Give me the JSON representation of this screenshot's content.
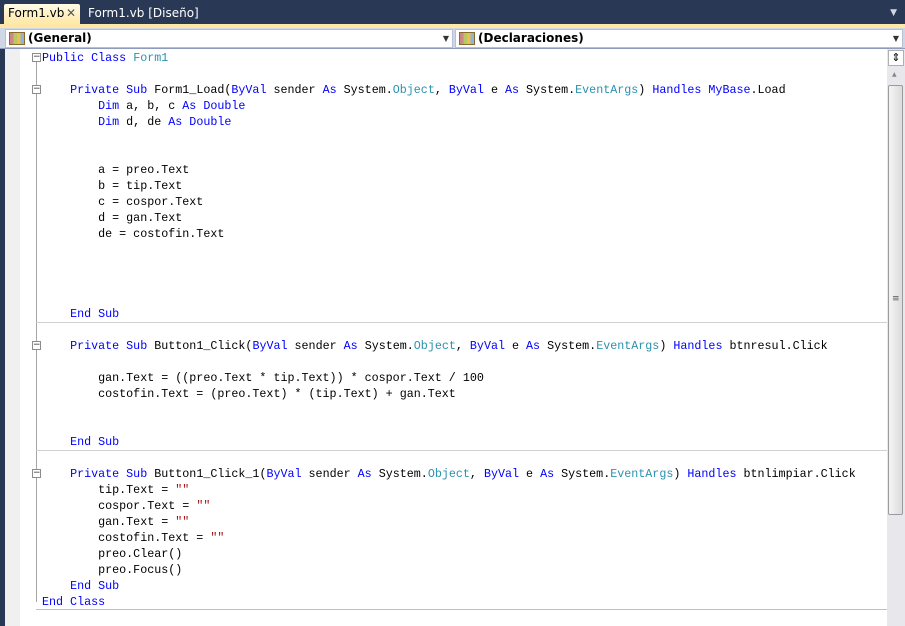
{
  "tabs": [
    {
      "label": "Form1.vb",
      "active": true,
      "close": "✕"
    },
    {
      "label": "Form1.vb [Diseño]",
      "active": false
    }
  ],
  "navbar": {
    "left_combo": "(General)",
    "right_combo": "(Declaraciones)"
  },
  "colors": {
    "keyword": "#0000ff",
    "type": "#2b91af",
    "string": "#a31515",
    "tab_bg": "#293955",
    "active_tab": "#ffe8a6"
  },
  "scroll": {
    "thumb_fraction": 0.79,
    "position_fraction": 0.0
  },
  "code": [
    [
      [
        "k",
        "Public Class "
      ],
      [
        "t",
        "Form1"
      ]
    ],
    [],
    [
      [
        "p",
        "    "
      ],
      [
        "k",
        "Private Sub "
      ],
      [
        "p",
        "Form1_Load("
      ],
      [
        "k",
        "ByVal "
      ],
      [
        "p",
        "sender "
      ],
      [
        "k",
        "As "
      ],
      [
        "p",
        "System."
      ],
      [
        "t",
        "Object"
      ],
      [
        "p",
        ", "
      ],
      [
        "k",
        "ByVal "
      ],
      [
        "p",
        "e "
      ],
      [
        "k",
        "As "
      ],
      [
        "p",
        "System."
      ],
      [
        "t",
        "EventArgs"
      ],
      [
        "p",
        ") "
      ],
      [
        "k",
        "Handles MyBase"
      ],
      [
        "p",
        ".Load"
      ]
    ],
    [
      [
        "p",
        "        "
      ],
      [
        "k",
        "Dim "
      ],
      [
        "p",
        "a, b, c "
      ],
      [
        "k",
        "As Double"
      ]
    ],
    [
      [
        "p",
        "        "
      ],
      [
        "k",
        "Dim "
      ],
      [
        "p",
        "d, de "
      ],
      [
        "k",
        "As Double"
      ]
    ],
    [],
    [],
    [
      [
        "p",
        "        a = preo.Text"
      ]
    ],
    [
      [
        "p",
        "        b = tip.Text"
      ]
    ],
    [
      [
        "p",
        "        c = cospor.Text"
      ]
    ],
    [
      [
        "p",
        "        d = gan.Text"
      ]
    ],
    [
      [
        "p",
        "        de = costofin.Text"
      ]
    ],
    [],
    [],
    [],
    [],
    [
      [
        "p",
        "    "
      ],
      [
        "k",
        "End Sub"
      ]
    ],
    [],
    [
      [
        "p",
        "    "
      ],
      [
        "k",
        "Private Sub "
      ],
      [
        "p",
        "Button1_Click("
      ],
      [
        "k",
        "ByVal "
      ],
      [
        "p",
        "sender "
      ],
      [
        "k",
        "As "
      ],
      [
        "p",
        "System."
      ],
      [
        "t",
        "Object"
      ],
      [
        "p",
        ", "
      ],
      [
        "k",
        "ByVal "
      ],
      [
        "p",
        "e "
      ],
      [
        "k",
        "As "
      ],
      [
        "p",
        "System."
      ],
      [
        "t",
        "EventArgs"
      ],
      [
        "p",
        ") "
      ],
      [
        "k",
        "Handles "
      ],
      [
        "p",
        "btnresul.Click"
      ]
    ],
    [],
    [
      [
        "p",
        "        gan.Text = ((preo.Text * tip.Text)) * cospor.Text / 100"
      ]
    ],
    [
      [
        "p",
        "        costofin.Text = (preo.Text) * (tip.Text) + gan.Text"
      ]
    ],
    [],
    [],
    [
      [
        "p",
        "    "
      ],
      [
        "k",
        "End Sub"
      ]
    ],
    [],
    [
      [
        "p",
        "    "
      ],
      [
        "k",
        "Private Sub "
      ],
      [
        "p",
        "Button1_Click_1("
      ],
      [
        "k",
        "ByVal "
      ],
      [
        "p",
        "sender "
      ],
      [
        "k",
        "As "
      ],
      [
        "p",
        "System."
      ],
      [
        "t",
        "Object"
      ],
      [
        "p",
        ", "
      ],
      [
        "k",
        "ByVal "
      ],
      [
        "p",
        "e "
      ],
      [
        "k",
        "As "
      ],
      [
        "p",
        "System."
      ],
      [
        "t",
        "EventArgs"
      ],
      [
        "p",
        ") "
      ],
      [
        "k",
        "Handles "
      ],
      [
        "p",
        "btnlimpiar.Click"
      ]
    ],
    [
      [
        "p",
        "        tip.Text = "
      ],
      [
        "s",
        "\"\""
      ]
    ],
    [
      [
        "p",
        "        cospor.Text = "
      ],
      [
        "s",
        "\"\""
      ]
    ],
    [
      [
        "p",
        "        gan.Text = "
      ],
      [
        "s",
        "\"\""
      ]
    ],
    [
      [
        "p",
        "        costofin.Text = "
      ],
      [
        "s",
        "\"\""
      ]
    ],
    [
      [
        "p",
        "        preo.Clear()"
      ]
    ],
    [
      [
        "p",
        "        preo.Focus()"
      ]
    ],
    [
      [
        "p",
        "    "
      ],
      [
        "k",
        "End Sub"
      ]
    ],
    [
      [
        "k",
        "End Class"
      ]
    ]
  ]
}
